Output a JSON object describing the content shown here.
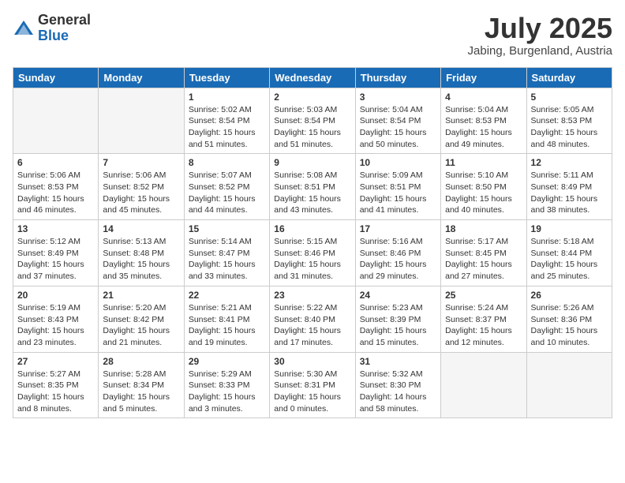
{
  "header": {
    "logo_general": "General",
    "logo_blue": "Blue",
    "month_title": "July 2025",
    "subtitle": "Jabing, Burgenland, Austria"
  },
  "days_of_week": [
    "Sunday",
    "Monday",
    "Tuesday",
    "Wednesday",
    "Thursday",
    "Friday",
    "Saturday"
  ],
  "weeks": [
    [
      {
        "day": "",
        "empty": true
      },
      {
        "day": "",
        "empty": true
      },
      {
        "day": "1",
        "sunrise": "Sunrise: 5:02 AM",
        "sunset": "Sunset: 8:54 PM",
        "daylight": "Daylight: 15 hours and 51 minutes."
      },
      {
        "day": "2",
        "sunrise": "Sunrise: 5:03 AM",
        "sunset": "Sunset: 8:54 PM",
        "daylight": "Daylight: 15 hours and 51 minutes."
      },
      {
        "day": "3",
        "sunrise": "Sunrise: 5:04 AM",
        "sunset": "Sunset: 8:54 PM",
        "daylight": "Daylight: 15 hours and 50 minutes."
      },
      {
        "day": "4",
        "sunrise": "Sunrise: 5:04 AM",
        "sunset": "Sunset: 8:53 PM",
        "daylight": "Daylight: 15 hours and 49 minutes."
      },
      {
        "day": "5",
        "sunrise": "Sunrise: 5:05 AM",
        "sunset": "Sunset: 8:53 PM",
        "daylight": "Daylight: 15 hours and 48 minutes."
      }
    ],
    [
      {
        "day": "6",
        "sunrise": "Sunrise: 5:06 AM",
        "sunset": "Sunset: 8:53 PM",
        "daylight": "Daylight: 15 hours and 46 minutes."
      },
      {
        "day": "7",
        "sunrise": "Sunrise: 5:06 AM",
        "sunset": "Sunset: 8:52 PM",
        "daylight": "Daylight: 15 hours and 45 minutes."
      },
      {
        "day": "8",
        "sunrise": "Sunrise: 5:07 AM",
        "sunset": "Sunset: 8:52 PM",
        "daylight": "Daylight: 15 hours and 44 minutes."
      },
      {
        "day": "9",
        "sunrise": "Sunrise: 5:08 AM",
        "sunset": "Sunset: 8:51 PM",
        "daylight": "Daylight: 15 hours and 43 minutes."
      },
      {
        "day": "10",
        "sunrise": "Sunrise: 5:09 AM",
        "sunset": "Sunset: 8:51 PM",
        "daylight": "Daylight: 15 hours and 41 minutes."
      },
      {
        "day": "11",
        "sunrise": "Sunrise: 5:10 AM",
        "sunset": "Sunset: 8:50 PM",
        "daylight": "Daylight: 15 hours and 40 minutes."
      },
      {
        "day": "12",
        "sunrise": "Sunrise: 5:11 AM",
        "sunset": "Sunset: 8:49 PM",
        "daylight": "Daylight: 15 hours and 38 minutes."
      }
    ],
    [
      {
        "day": "13",
        "sunrise": "Sunrise: 5:12 AM",
        "sunset": "Sunset: 8:49 PM",
        "daylight": "Daylight: 15 hours and 37 minutes."
      },
      {
        "day": "14",
        "sunrise": "Sunrise: 5:13 AM",
        "sunset": "Sunset: 8:48 PM",
        "daylight": "Daylight: 15 hours and 35 minutes."
      },
      {
        "day": "15",
        "sunrise": "Sunrise: 5:14 AM",
        "sunset": "Sunset: 8:47 PM",
        "daylight": "Daylight: 15 hours and 33 minutes."
      },
      {
        "day": "16",
        "sunrise": "Sunrise: 5:15 AM",
        "sunset": "Sunset: 8:46 PM",
        "daylight": "Daylight: 15 hours and 31 minutes."
      },
      {
        "day": "17",
        "sunrise": "Sunrise: 5:16 AM",
        "sunset": "Sunset: 8:46 PM",
        "daylight": "Daylight: 15 hours and 29 minutes."
      },
      {
        "day": "18",
        "sunrise": "Sunrise: 5:17 AM",
        "sunset": "Sunset: 8:45 PM",
        "daylight": "Daylight: 15 hours and 27 minutes."
      },
      {
        "day": "19",
        "sunrise": "Sunrise: 5:18 AM",
        "sunset": "Sunset: 8:44 PM",
        "daylight": "Daylight: 15 hours and 25 minutes."
      }
    ],
    [
      {
        "day": "20",
        "sunrise": "Sunrise: 5:19 AM",
        "sunset": "Sunset: 8:43 PM",
        "daylight": "Daylight: 15 hours and 23 minutes."
      },
      {
        "day": "21",
        "sunrise": "Sunrise: 5:20 AM",
        "sunset": "Sunset: 8:42 PM",
        "daylight": "Daylight: 15 hours and 21 minutes."
      },
      {
        "day": "22",
        "sunrise": "Sunrise: 5:21 AM",
        "sunset": "Sunset: 8:41 PM",
        "daylight": "Daylight: 15 hours and 19 minutes."
      },
      {
        "day": "23",
        "sunrise": "Sunrise: 5:22 AM",
        "sunset": "Sunset: 8:40 PM",
        "daylight": "Daylight: 15 hours and 17 minutes."
      },
      {
        "day": "24",
        "sunrise": "Sunrise: 5:23 AM",
        "sunset": "Sunset: 8:39 PM",
        "daylight": "Daylight: 15 hours and 15 minutes."
      },
      {
        "day": "25",
        "sunrise": "Sunrise: 5:24 AM",
        "sunset": "Sunset: 8:37 PM",
        "daylight": "Daylight: 15 hours and 12 minutes."
      },
      {
        "day": "26",
        "sunrise": "Sunrise: 5:26 AM",
        "sunset": "Sunset: 8:36 PM",
        "daylight": "Daylight: 15 hours and 10 minutes."
      }
    ],
    [
      {
        "day": "27",
        "sunrise": "Sunrise: 5:27 AM",
        "sunset": "Sunset: 8:35 PM",
        "daylight": "Daylight: 15 hours and 8 minutes."
      },
      {
        "day": "28",
        "sunrise": "Sunrise: 5:28 AM",
        "sunset": "Sunset: 8:34 PM",
        "daylight": "Daylight: 15 hours and 5 minutes."
      },
      {
        "day": "29",
        "sunrise": "Sunrise: 5:29 AM",
        "sunset": "Sunset: 8:33 PM",
        "daylight": "Daylight: 15 hours and 3 minutes."
      },
      {
        "day": "30",
        "sunrise": "Sunrise: 5:30 AM",
        "sunset": "Sunset: 8:31 PM",
        "daylight": "Daylight: 15 hours and 0 minutes."
      },
      {
        "day": "31",
        "sunrise": "Sunrise: 5:32 AM",
        "sunset": "Sunset: 8:30 PM",
        "daylight": "Daylight: 14 hours and 58 minutes."
      },
      {
        "day": "",
        "empty": true
      },
      {
        "day": "",
        "empty": true
      }
    ]
  ]
}
